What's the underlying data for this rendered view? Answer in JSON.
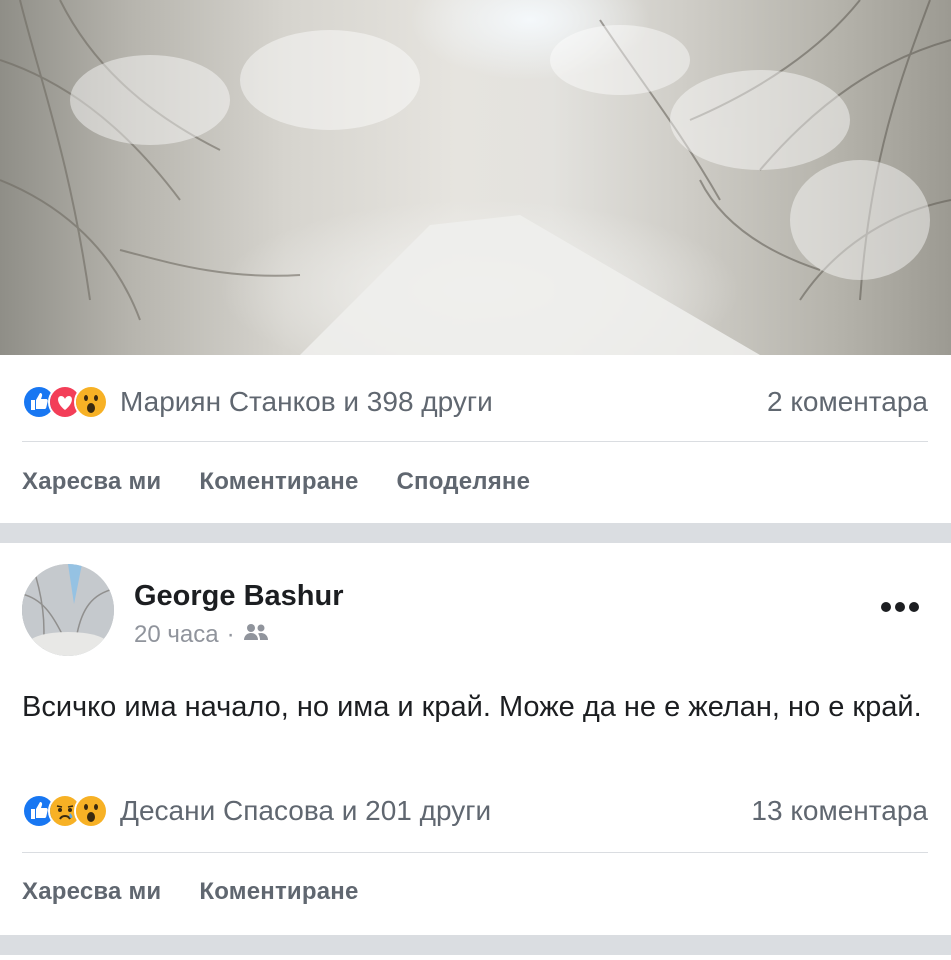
{
  "post1": {
    "reactions": {
      "emojis": [
        "like-icon",
        "love-icon",
        "wow-icon"
      ],
      "text": "Мариян Станков и 398 други"
    },
    "comments": "2 коментара",
    "actions": {
      "like": "Харесва ми",
      "comment": "Коментиране",
      "share": "Споделяне"
    }
  },
  "post2": {
    "author": "George Bashur",
    "time": "20 часа",
    "separator": "·",
    "audience_icon": "friends-icon",
    "text": "Всичко има начало, но има и край. Може да не е желан, но е край.",
    "reactions": {
      "emojis": [
        "like-icon",
        "sad-icon",
        "wow-icon"
      ],
      "text": "Десани Спасова и 201 други"
    },
    "comments": "13 коментара",
    "actions": {
      "like": "Харесва ми",
      "comment": "Коментиране"
    }
  },
  "colors": {
    "like_blue": "#1877f2",
    "love_red": "#f33e58",
    "wow_yellow": "#f7b125",
    "meta_gray": "#606770",
    "divider": "#dadde1"
  }
}
